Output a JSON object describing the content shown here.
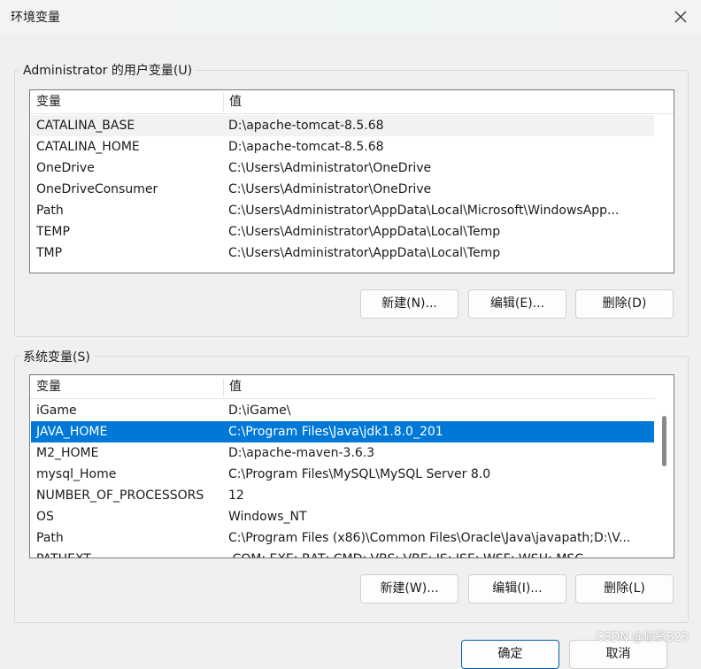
{
  "window": {
    "title": "环境变量"
  },
  "user_vars": {
    "group_label": "Administrator 的用户变量(U)",
    "headers": {
      "name": "变量",
      "value": "值"
    },
    "rows": [
      {
        "name": "CATALINA_BASE",
        "value": "D:\\apache-tomcat-8.5.68"
      },
      {
        "name": "CATALINA_HOME",
        "value": "D:\\apache-tomcat-8.5.68"
      },
      {
        "name": "OneDrive",
        "value": "C:\\Users\\Administrator\\OneDrive"
      },
      {
        "name": "OneDriveConsumer",
        "value": "C:\\Users\\Administrator\\OneDrive"
      },
      {
        "name": "Path",
        "value": "C:\\Users\\Administrator\\AppData\\Local\\Microsoft\\WindowsApp..."
      },
      {
        "name": "TEMP",
        "value": "C:\\Users\\Administrator\\AppData\\Local\\Temp"
      },
      {
        "name": "TMP",
        "value": "C:\\Users\\Administrator\\AppData\\Local\\Temp"
      }
    ],
    "buttons": {
      "new": "新建(N)...",
      "edit": "编辑(E)...",
      "delete": "删除(D)"
    }
  },
  "system_vars": {
    "group_label": "系统变量(S)",
    "headers": {
      "name": "变量",
      "value": "值"
    },
    "rows": [
      {
        "name": "iGame",
        "value": "D:\\iGame\\"
      },
      {
        "name": "JAVA_HOME",
        "value": "C:\\Program Files\\Java\\jdk1.8.0_201"
      },
      {
        "name": "M2_HOME",
        "value": "D:\\apache-maven-3.6.3"
      },
      {
        "name": "mysql_Home",
        "value": "C:\\Program Files\\MySQL\\MySQL Server 8.0"
      },
      {
        "name": "NUMBER_OF_PROCESSORS",
        "value": "12"
      },
      {
        "name": "OS",
        "value": "Windows_NT"
      },
      {
        "name": "Path",
        "value": "C:\\Program Files (x86)\\Common Files\\Oracle\\Java\\javapath;D:\\V..."
      },
      {
        "name": "PATHEXT",
        "value": ".COM;.EXE;.BAT;.CMD;.VBS;.VBE;.JS;.JSE;.WSF;.WSH;.MSC"
      }
    ],
    "selected_row": "JAVA_HOME",
    "buttons": {
      "new": "新建(W)...",
      "edit": "编辑(I)...",
      "delete": "删除(L)"
    }
  },
  "footer": {
    "ok": "确定",
    "cancel": "取消"
  },
  "watermark": "CSDN @修贤323",
  "icons": {
    "close": "close-icon"
  },
  "colors": {
    "selection": "#0078d7",
    "primary_border": "#005fb8"
  }
}
